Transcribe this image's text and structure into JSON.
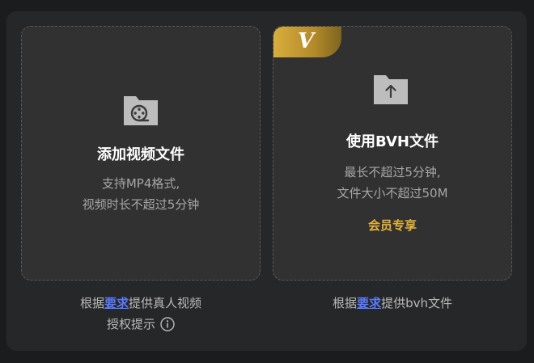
{
  "left_card": {
    "title": "添加视频文件",
    "desc_line1": "支持MP4格式,",
    "desc_line2": "视频时长不超过5分钟",
    "icon": "video-folder-icon"
  },
  "right_card": {
    "badge": "V",
    "title": "使用BVH文件",
    "desc_line1": "最长不超过5分钟,",
    "desc_line2": "文件大小不超过50M",
    "vip_label": "会员专享",
    "icon": "upload-folder-icon"
  },
  "left_note": {
    "prefix": "根据",
    "link": "要求",
    "suffix": "提供真人视频",
    "line2": "授权提示"
  },
  "right_note": {
    "prefix": "根据",
    "link": "要求",
    "suffix": "提供bvh文件"
  },
  "colors": {
    "accent_link": "#5b7cff",
    "vip_gold": "#e5b23c"
  }
}
